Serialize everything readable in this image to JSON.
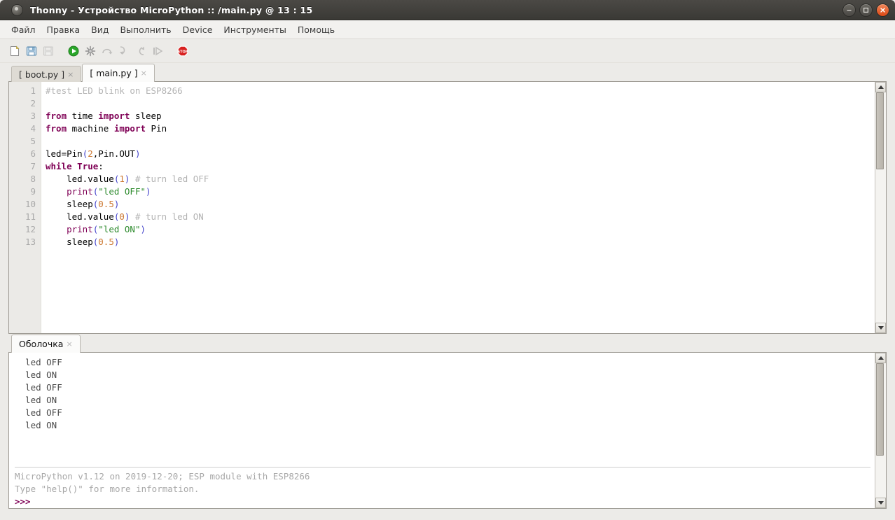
{
  "window": {
    "title": "Thonny  -  Устройство MicroPython ::  /main.py  @  13 : 15",
    "app_icon": "thonny-app-icon",
    "controls": [
      {
        "name": "minimize-button",
        "glyph": "minimize-icon"
      },
      {
        "name": "maximize-button",
        "glyph": "maximize-icon"
      },
      {
        "name": "close-button",
        "glyph": "close-icon"
      }
    ]
  },
  "menubar": {
    "items": [
      {
        "label": "Файл"
      },
      {
        "label": "Правка"
      },
      {
        "label": "Вид"
      },
      {
        "label": "Выполнить"
      },
      {
        "label": "Device"
      },
      {
        "label": "Инструменты"
      },
      {
        "label": "Помощь"
      }
    ]
  },
  "toolbar": {
    "buttons": [
      {
        "name": "new-file-button",
        "icon": "new-file-icon",
        "enabled": true
      },
      {
        "name": "open-file-button",
        "icon": "open-folder-icon",
        "enabled": true
      },
      {
        "name": "save-file-button",
        "icon": "save-disk-icon",
        "enabled": false
      },
      {
        "name": "run-button",
        "icon": "play-icon",
        "enabled": true
      },
      {
        "name": "debug-button",
        "icon": "debug-star-icon",
        "enabled": true
      },
      {
        "name": "step-over-button",
        "icon": "step-over-icon",
        "enabled": false
      },
      {
        "name": "step-into-button",
        "icon": "step-into-icon",
        "enabled": false
      },
      {
        "name": "step-out-button",
        "icon": "step-out-icon",
        "enabled": false
      },
      {
        "name": "resume-button",
        "icon": "resume-icon",
        "enabled": false
      },
      {
        "name": "stop-button",
        "icon": "stop-sign-icon",
        "enabled": true
      }
    ]
  },
  "editor": {
    "tabs": [
      {
        "label": "[ boot.py ]",
        "active": false,
        "close": "×"
      },
      {
        "label": "[ main.py ]",
        "active": true,
        "close": "×"
      }
    ],
    "line_numbers": [
      "1",
      "2",
      "3",
      "4",
      "5",
      "6",
      "7",
      "8",
      "9",
      "10",
      "11",
      "12",
      "13"
    ],
    "lines": [
      {
        "n": 1,
        "text": "#test LED blink on ESP8266"
      },
      {
        "n": 2,
        "text": ""
      },
      {
        "n": 3,
        "text": "from time import sleep"
      },
      {
        "n": 4,
        "text": "from machine import Pin"
      },
      {
        "n": 5,
        "text": ""
      },
      {
        "n": 6,
        "text": "led=Pin(2,Pin.OUT)"
      },
      {
        "n": 7,
        "text": "while True:"
      },
      {
        "n": 8,
        "text": "    led.value(1) # turn led OFF"
      },
      {
        "n": 9,
        "text": "    print(\"led OFF\")"
      },
      {
        "n": 10,
        "text": "    sleep(0.5)"
      },
      {
        "n": 11,
        "text": "    led.value(0) # turn led ON"
      },
      {
        "n": 12,
        "text": "    print(\"led ON\")"
      },
      {
        "n": 13,
        "text": "    sleep(0.5)"
      }
    ],
    "scrollbar": {
      "up": "scroll-up-arrow",
      "down": "scroll-down-arrow"
    }
  },
  "shell": {
    "tab_label": "Оболочка",
    "tab_close": "×",
    "output_lines": [
      "  led OFF",
      "  led ON",
      "  led OFF",
      "  led ON",
      "  led OFF",
      "  led ON"
    ],
    "banner_lines": [
      "MicroPython v1.12 on 2019-12-20; ESP module with ESP8266",
      "Type \"help()\" for more information."
    ],
    "prompt": ">>>"
  },
  "colors": {
    "titlebar": "#3d3b37",
    "close_button": "#dd4814",
    "keyword": "#7f0055",
    "string": "#2e8b2e",
    "number": "#cc7832",
    "comment": "#b3b3b3",
    "paren": "#4444cc",
    "window_bg": "#ecebe8",
    "editor_bg": "#ffffff",
    "gutter_bg": "#ebeae7"
  }
}
